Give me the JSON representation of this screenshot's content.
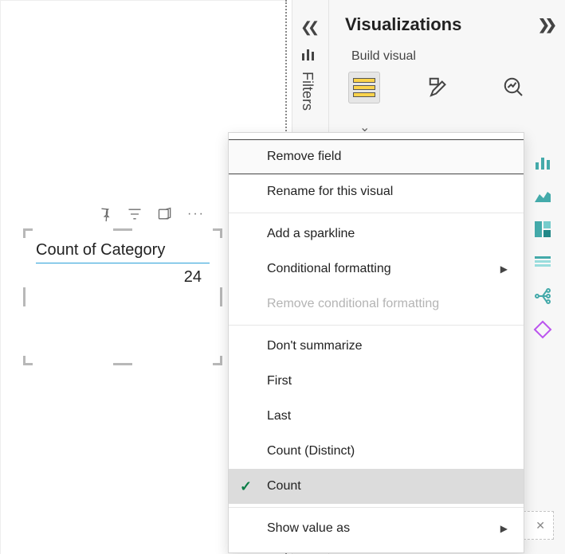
{
  "card": {
    "title": "Count of Category",
    "value": "24"
  },
  "filters_pane": {
    "label": "Filters"
  },
  "viz_pane": {
    "title": "Visualizations",
    "subtitle": "Build visual"
  },
  "context_menu": {
    "items": [
      {
        "label": "Remove field",
        "kind": "item",
        "state": "highlight"
      },
      {
        "label": "Rename for this visual",
        "kind": "item"
      },
      {
        "kind": "sep"
      },
      {
        "label": "Add a sparkline",
        "kind": "item"
      },
      {
        "label": "Conditional formatting",
        "kind": "submenu"
      },
      {
        "label": "Remove conditional formatting",
        "kind": "item",
        "state": "disabled"
      },
      {
        "kind": "sep"
      },
      {
        "label": "Don't summarize",
        "kind": "item"
      },
      {
        "label": "First",
        "kind": "item"
      },
      {
        "label": "Last",
        "kind": "item"
      },
      {
        "label": "Count (Distinct)",
        "kind": "item"
      },
      {
        "label": "Count",
        "kind": "item",
        "state": "selected"
      },
      {
        "kind": "sep"
      },
      {
        "label": "Show value as",
        "kind": "submenu"
      }
    ]
  }
}
